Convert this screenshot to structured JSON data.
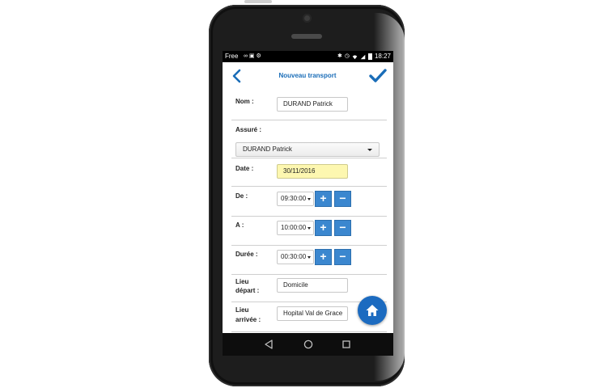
{
  "status_bar": {
    "carrier": "Free",
    "time": "18:27"
  },
  "app_bar": {
    "title": "Nouveau transport",
    "back_icon": "chevron-left-icon",
    "validate_icon": "checkmark-icon"
  },
  "form": {
    "nom": {
      "label": "Nom :",
      "value": "DURAND Patrick"
    },
    "assure": {
      "label": "Assuré :",
      "selected": "DURAND Patrick"
    },
    "date": {
      "label": "Date :",
      "value": "30/11/2016"
    },
    "de": {
      "label": "De :",
      "value": "09:30:00"
    },
    "a": {
      "label": "A :",
      "value": "10:00:00"
    },
    "duree": {
      "label": "Durée :",
      "value": "00:30:00"
    },
    "lieu_depart": {
      "label_line1": "Lieu",
      "label_line2": "départ :",
      "value": "Domicile"
    },
    "lieu_arrivee": {
      "label_line1": "Lieu",
      "label_line2": "arrivée :",
      "value": "Hopital Val de Grace"
    }
  },
  "stepper": {
    "plus": "+",
    "minus": "−"
  },
  "fab_icon": "home-icon",
  "nav_icons": [
    "back-triangle-icon",
    "home-circle-icon",
    "recents-square-icon"
  ],
  "colors": {
    "accent": "#1a6db8",
    "button_blue": "#3b87cf",
    "date_field": "#fdf7b0"
  }
}
